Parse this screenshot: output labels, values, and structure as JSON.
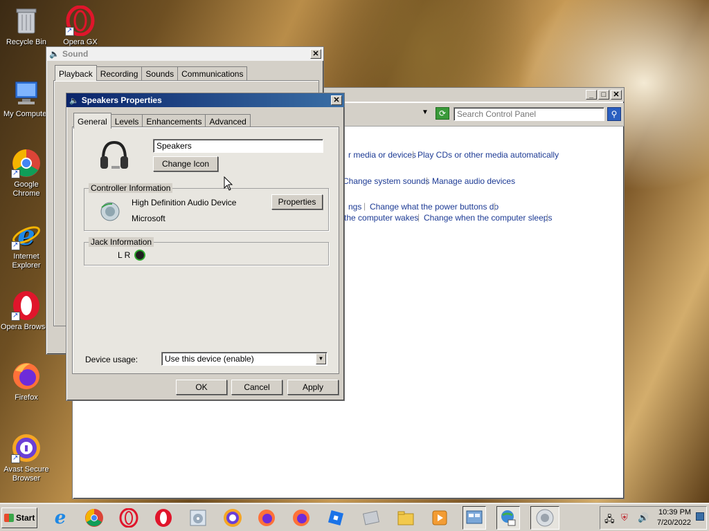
{
  "desktop": {
    "icons": [
      {
        "label": "Recycle Bin"
      },
      {
        "label": "Opera GX"
      },
      {
        "label": "My Computer"
      },
      {
        "label": "Google Chrome"
      },
      {
        "label": "Internet Explorer"
      },
      {
        "label": "Opera Browser"
      },
      {
        "label": "Firefox"
      },
      {
        "label": "Avast Secure Browser"
      }
    ]
  },
  "sound_window": {
    "title": "Sound",
    "tabs": [
      "Playback",
      "Recording",
      "Sounds",
      "Communications"
    ],
    "close": "✕"
  },
  "control_panel": {
    "search_placeholder": "Search Control Panel",
    "links_row1": [
      "r media or devices",
      "Play CDs or other media automatically"
    ],
    "links_row2": [
      "Change system sounds",
      "Manage audio devices"
    ],
    "links_row3": [
      "ngs",
      "Change what the power buttons do"
    ],
    "links_row4": [
      "the computer wakes",
      "Change when the computer sleeps"
    ]
  },
  "speakers_dialog": {
    "title": "Speakers Properties",
    "close": "✕",
    "tabs": [
      "General",
      "Levels",
      "Enhancements",
      "Advanced"
    ],
    "device_name": "Speakers",
    "change_icon": "Change Icon",
    "controller_group": "Controller Information",
    "controller_name": "High Definition Audio Device",
    "controller_vendor": "Microsoft",
    "properties_btn": "Properties",
    "jack_group": "Jack Information",
    "jack_label": "L R",
    "device_usage_label": "Device usage:",
    "device_usage_value": "Use this device (enable)",
    "ok": "OK",
    "cancel": "Cancel",
    "apply": "Apply"
  },
  "taskbar": {
    "start": "Start",
    "time": "10:39 PM",
    "date": "7/20/2022"
  }
}
